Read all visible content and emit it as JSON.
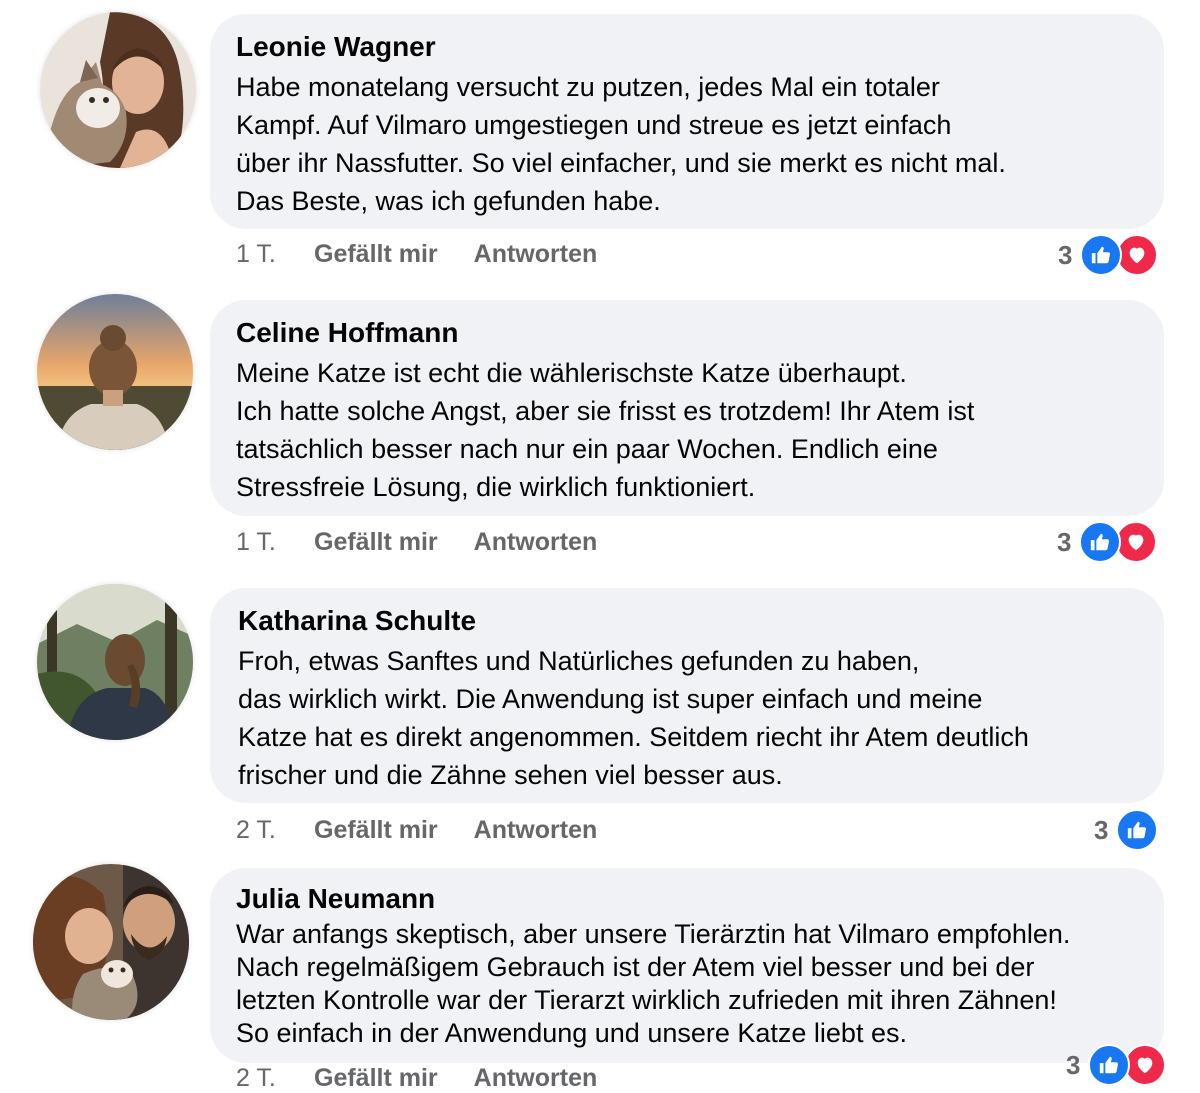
{
  "comments": [
    {
      "author": "Leonie Wagner",
      "lines": [
        "Habe monatelang versucht zu putzen, jedes Mal ein totaler",
        "Kampf. Auf Vilmaro umgestiegen und streue es jetzt einfach",
        "über ihr Nassfutter. So viel einfacher, und sie merkt es nicht mal.",
        "Das Beste, was ich gefunden habe."
      ],
      "age": "1 T.",
      "like_label": "Gefällt mir",
      "reply_label": "Antworten",
      "reaction_count": "3",
      "reactions": [
        "like-icon",
        "heart-icon"
      ]
    },
    {
      "author": "Celine Hoffmann",
      "lines": [
        "Meine Katze ist echt die wählerischste Katze überhaupt.",
        "Ich hatte solche Angst, aber sie frisst es trotzdem! Ihr Atem ist",
        "tatsächlich besser nach nur ein paar Wochen. Endlich eine",
        "Stressfreie Lösung, die wirklich funktioniert."
      ],
      "age": "1 T.",
      "like_label": "Gefällt mir",
      "reply_label": "Antworten",
      "reaction_count": "3",
      "reactions": [
        "like-icon",
        "heart-icon"
      ]
    },
    {
      "author": "Katharina Schulte",
      "lines": [
        "Froh, etwas Sanftes und Natürliches gefunden zu haben,",
        "das wirklich wirkt. Die Anwendung ist super einfach und meine",
        "Katze hat es direkt angenommen. Seitdem riecht ihr Atem deutlich",
        "frischer und die Zähne sehen viel besser aus."
      ],
      "age": "2 T.",
      "like_label": "Gefällt mir",
      "reply_label": "Antworten",
      "reaction_count": "3",
      "reactions": [
        "like-icon"
      ]
    },
    {
      "author": "Julia Neumann",
      "lines": [
        "War anfangs skeptisch, aber unsere Tierärztin hat Vilmaro empfohlen.",
        "Nach regelmäßigem Gebrauch ist der Atem viel besser und bei der",
        "letzten Kontrolle war der Tierarzt wirklich zufrieden mit ihren Zähnen!",
        "So einfach in der Anwendung und unsere Katze liebt es."
      ],
      "age": "2 T.",
      "like_label": "Gefällt mir",
      "reply_label": "Antworten",
      "reaction_count": "3",
      "reactions": [
        "like-icon",
        "heart-icon"
      ]
    }
  ],
  "colors": {
    "bubble": "#f0f2f5",
    "meta_text": "#65676b",
    "like_blue": "#1877f2",
    "heart_red": "#f0284a"
  }
}
